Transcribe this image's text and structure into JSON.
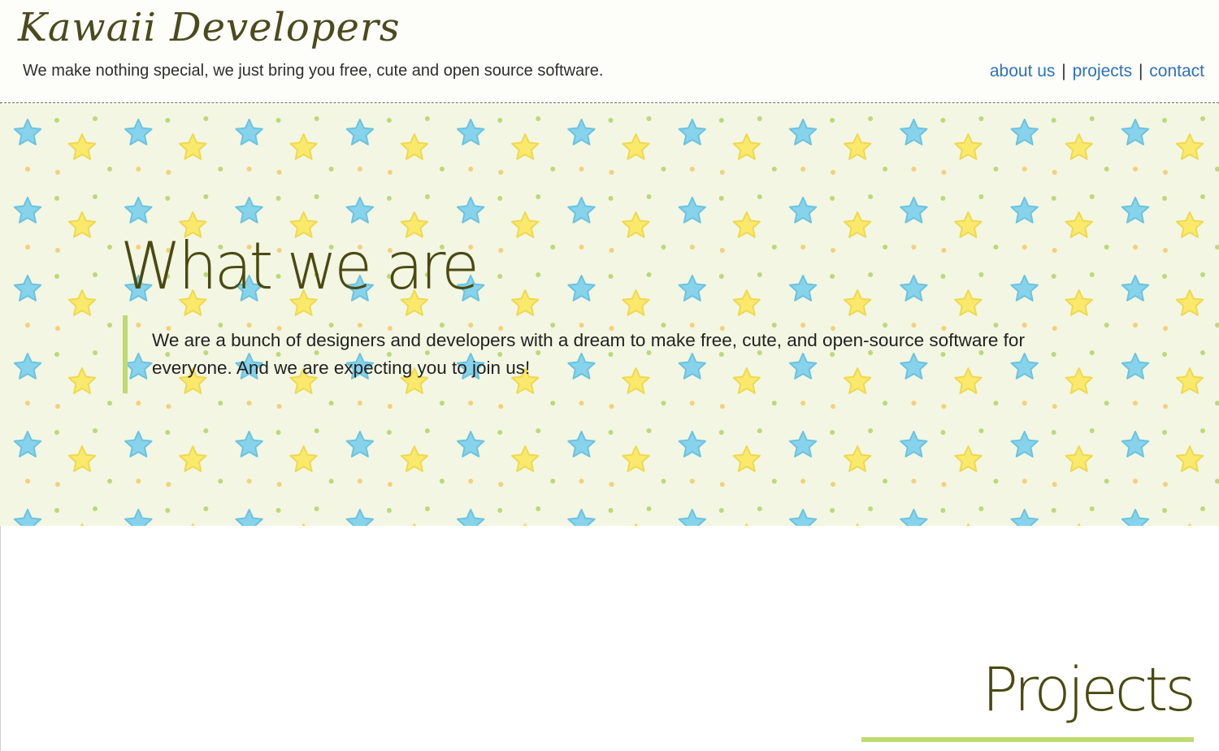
{
  "header": {
    "logo": "Kawaii Developers",
    "tagline": "We make nothing special, we just bring you free, cute and open source software.",
    "nav": [
      {
        "label": "about us"
      },
      {
        "label": "projects"
      },
      {
        "label": "contact"
      }
    ],
    "nav_separator": "|"
  },
  "about": {
    "title": "What we are",
    "text": "We are a bunch of designers and developers with a dream to make free, cute, and open-source software for everyone. And we are expecting you to join us!"
  },
  "projects": {
    "title": "Projects"
  },
  "colors": {
    "accent_green": "#bfdb70",
    "link_blue": "#2f72b6",
    "hero_bg": "#f2f6e2",
    "star_blue": "#87d3ec",
    "star_yellow": "#fbe96c"
  }
}
